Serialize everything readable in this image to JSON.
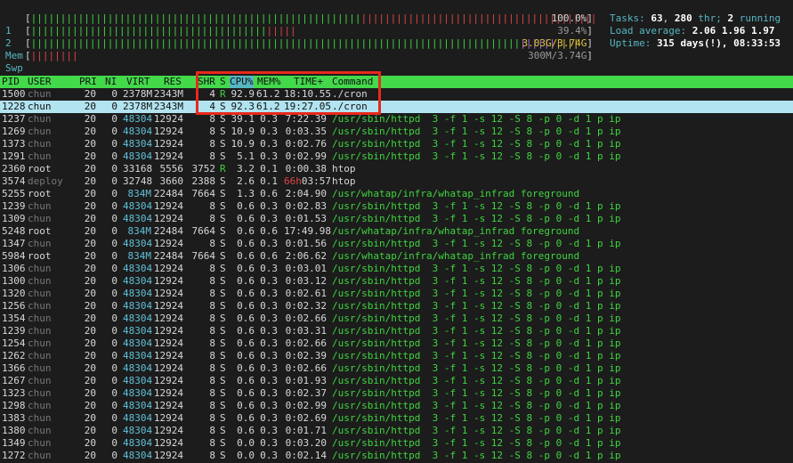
{
  "meters": [
    {
      "label": "1",
      "value": "100.0%"
    },
    {
      "label": "2",
      "value": "39.4%"
    },
    {
      "label": "Mem",
      "value": "3.03G/3.74G"
    },
    {
      "label": "Swp",
      "value": "300M/3.74G"
    }
  ],
  "summary": {
    "tasks_label": "Tasks: ",
    "tasks": "63",
    "tasks_sep": ", ",
    "threads": "280",
    "threads_label": " thr; ",
    "running": "2",
    "running_label": " running",
    "load_label": "Load average: ",
    "load1": "2.06",
    "load5": "1.96",
    "load15": "1.97",
    "uptime_label": "Uptime: ",
    "uptime": "315 days(!), 08:33:53"
  },
  "columns": {
    "pid": "PID",
    "user": "USER",
    "pri": "PRI",
    "ni": "NI",
    "virt": "VIRT",
    "res": "RES",
    "shr": "SHR",
    "s": "S",
    "cpu": "CPU%",
    "mem": "MEM%",
    "time": "TIME+",
    "cmd": "Command"
  },
  "processes": [
    {
      "pid": "1500",
      "user": "chun",
      "pri": "20",
      "ni": "0",
      "virt": "2378M",
      "res": "2343M",
      "shr": "4",
      "s": "R",
      "cpu": "92.9",
      "mem": "61.2",
      "time": "18:10.55",
      "cmd": "./cron"
    },
    {
      "pid": "1228",
      "user": "chun",
      "pri": "20",
      "ni": "0",
      "virt": "2378M",
      "res": "2343M",
      "shr": "4",
      "s": "S",
      "cpu": "92.3",
      "mem": "61.2",
      "time": "19:27.05",
      "cmd": "./cron"
    },
    {
      "pid": "1237",
      "user": "chun",
      "pri": "20",
      "ni": "0",
      "virt": "48304",
      "res": "12924",
      "shr": "8",
      "s": "S",
      "cpu": "39.1",
      "mem": "0.3",
      "time": "7:22.39",
      "cmd": "/usr/sbin/httpd  3 -f 1 -s 12 -S 8 -p 0 -d 1 p ip"
    },
    {
      "pid": "1269",
      "user": "chun",
      "pri": "20",
      "ni": "0",
      "virt": "48304",
      "res": "12924",
      "shr": "8",
      "s": "S",
      "cpu": "10.9",
      "mem": "0.3",
      "time": "0:03.35",
      "cmd": "/usr/sbin/httpd  3 -f 1 -s 12 -S 8 -p 0 -d 1 p ip"
    },
    {
      "pid": "1373",
      "user": "chun",
      "pri": "20",
      "ni": "0",
      "virt": "48304",
      "res": "12924",
      "shr": "8",
      "s": "S",
      "cpu": "10.9",
      "mem": "0.3",
      "time": "0:02.76",
      "cmd": "/usr/sbin/httpd  3 -f 1 -s 12 -S 8 -p 0 -d 1 p ip"
    },
    {
      "pid": "1291",
      "user": "chun",
      "pri": "20",
      "ni": "0",
      "virt": "48304",
      "res": "12924",
      "shr": "8",
      "s": "S",
      "cpu": "5.1",
      "mem": "0.3",
      "time": "0:02.99",
      "cmd": "/usr/sbin/httpd  3 -f 1 -s 12 -S 8 -p 0 -d 1 p ip"
    },
    {
      "pid": "2360",
      "user": "root",
      "pri": "20",
      "ni": "0",
      "virt": "33168",
      "res": "5556",
      "shr": "3752",
      "s": "R",
      "cpu": "3.2",
      "mem": "0.1",
      "time": "0:00.38",
      "cmd": "htop"
    },
    {
      "pid": "3574",
      "user": "deploy",
      "pri": "20",
      "ni": "0",
      "virt": "32748",
      "res": "3660",
      "shr": "2388",
      "s": "S",
      "cpu": "2.6",
      "mem": "0.1",
      "time_h": "66h",
      "time": "03:57",
      "cmd": "htop"
    },
    {
      "pid": "5255",
      "user": "root",
      "pri": "20",
      "ni": "0",
      "virt": "834M",
      "res": "22484",
      "shr": "7664",
      "s": "S",
      "cpu": "1.3",
      "mem": "0.6",
      "time": "2:04.90",
      "cmd": "/usr/whatap/infra/whatap_infrad foreground"
    },
    {
      "pid": "1239",
      "user": "chun",
      "pri": "20",
      "ni": "0",
      "virt": "48304",
      "res": "12924",
      "shr": "8",
      "s": "S",
      "cpu": "0.6",
      "mem": "0.3",
      "time": "0:02.83",
      "cmd": "/usr/sbin/httpd  3 -f 1 -s 12 -S 8 -p 0 -d 1 p ip"
    },
    {
      "pid": "1309",
      "user": "chun",
      "pri": "20",
      "ni": "0",
      "virt": "48304",
      "res": "12924",
      "shr": "8",
      "s": "S",
      "cpu": "0.6",
      "mem": "0.3",
      "time": "0:01.53",
      "cmd": "/usr/sbin/httpd  3 -f 1 -s 12 -S 8 -p 0 -d 1 p ip"
    },
    {
      "pid": "5248",
      "user": "root",
      "pri": "20",
      "ni": "0",
      "virt": "834M",
      "res": "22484",
      "shr": "7664",
      "s": "S",
      "cpu": "0.6",
      "mem": "0.6",
      "time": "17:49.98",
      "cmd": "/usr/whatap/infra/whatap_infrad foreground"
    },
    {
      "pid": "1347",
      "user": "chun",
      "pri": "20",
      "ni": "0",
      "virt": "48304",
      "res": "12924",
      "shr": "8",
      "s": "S",
      "cpu": "0.6",
      "mem": "0.3",
      "time": "0:01.56",
      "cmd": "/usr/sbin/httpd  3 -f 1 -s 12 -S 8 -p 0 -d 1 p ip"
    },
    {
      "pid": "5984",
      "user": "root",
      "pri": "20",
      "ni": "0",
      "virt": "834M",
      "res": "22484",
      "shr": "7664",
      "s": "S",
      "cpu": "0.6",
      "mem": "0.6",
      "time": "2:06.62",
      "cmd": "/usr/whatap/infra/whatap_infrad foreground"
    },
    {
      "pid": "1306",
      "user": "chun",
      "pri": "20",
      "ni": "0",
      "virt": "48304",
      "res": "12924",
      "shr": "8",
      "s": "S",
      "cpu": "0.6",
      "mem": "0.3",
      "time": "0:03.01",
      "cmd": "/usr/sbin/httpd  3 -f 1 -s 12 -S 8 -p 0 -d 1 p ip"
    },
    {
      "pid": "1300",
      "user": "chun",
      "pri": "20",
      "ni": "0",
      "virt": "48304",
      "res": "12924",
      "shr": "8",
      "s": "S",
      "cpu": "0.6",
      "mem": "0.3",
      "time": "0:03.12",
      "cmd": "/usr/sbin/httpd  3 -f 1 -s 12 -S 8 -p 0 -d 1 p ip"
    },
    {
      "pid": "1320",
      "user": "chun",
      "pri": "20",
      "ni": "0",
      "virt": "48304",
      "res": "12924",
      "shr": "8",
      "s": "S",
      "cpu": "0.6",
      "mem": "0.3",
      "time": "0:02.61",
      "cmd": "/usr/sbin/httpd  3 -f 1 -s 12 -S 8 -p 0 -d 1 p ip"
    },
    {
      "pid": "1256",
      "user": "chun",
      "pri": "20",
      "ni": "0",
      "virt": "48304",
      "res": "12924",
      "shr": "8",
      "s": "S",
      "cpu": "0.6",
      "mem": "0.3",
      "time": "0:02.32",
      "cmd": "/usr/sbin/httpd  3 -f 1 -s 12 -S 8 -p 0 -d 1 p ip"
    },
    {
      "pid": "1354",
      "user": "chun",
      "pri": "20",
      "ni": "0",
      "virt": "48304",
      "res": "12924",
      "shr": "8",
      "s": "S",
      "cpu": "0.6",
      "mem": "0.3",
      "time": "0:02.66",
      "cmd": "/usr/sbin/httpd  3 -f 1 -s 12 -S 8 -p 0 -d 1 p ip"
    },
    {
      "pid": "1239",
      "user": "chun",
      "pri": "20",
      "ni": "0",
      "virt": "48304",
      "res": "12924",
      "shr": "8",
      "s": "S",
      "cpu": "0.6",
      "mem": "0.3",
      "time": "0:03.31",
      "cmd": "/usr/sbin/httpd  3 -f 1 -s 12 -S 8 -p 0 -d 1 p ip"
    },
    {
      "pid": "1254",
      "user": "chun",
      "pri": "20",
      "ni": "0",
      "virt": "48304",
      "res": "12924",
      "shr": "8",
      "s": "S",
      "cpu": "0.6",
      "mem": "0.3",
      "time": "0:02.66",
      "cmd": "/usr/sbin/httpd  3 -f 1 -s 12 -S 8 -p 0 -d 1 p ip"
    },
    {
      "pid": "1262",
      "user": "chun",
      "pri": "20",
      "ni": "0",
      "virt": "48304",
      "res": "12924",
      "shr": "8",
      "s": "S",
      "cpu": "0.6",
      "mem": "0.3",
      "time": "0:02.39",
      "cmd": "/usr/sbin/httpd  3 -f 1 -s 12 -S 8 -p 0 -d 1 p ip"
    },
    {
      "pid": "1366",
      "user": "chun",
      "pri": "20",
      "ni": "0",
      "virt": "48304",
      "res": "12924",
      "shr": "8",
      "s": "S",
      "cpu": "0.6",
      "mem": "0.3",
      "time": "0:02.66",
      "cmd": "/usr/sbin/httpd  3 -f 1 -s 12 -S 8 -p 0 -d 1 p ip"
    },
    {
      "pid": "1267",
      "user": "chun",
      "pri": "20",
      "ni": "0",
      "virt": "48304",
      "res": "12924",
      "shr": "8",
      "s": "S",
      "cpu": "0.6",
      "mem": "0.3",
      "time": "0:01.93",
      "cmd": "/usr/sbin/httpd  3 -f 1 -s 12 -S 8 -p 0 -d 1 p ip"
    },
    {
      "pid": "1323",
      "user": "chun",
      "pri": "20",
      "ni": "0",
      "virt": "48304",
      "res": "12924",
      "shr": "8",
      "s": "S",
      "cpu": "0.6",
      "mem": "0.3",
      "time": "0:02.37",
      "cmd": "/usr/sbin/httpd  3 -f 1 -s 12 -S 8 -p 0 -d 1 p ip"
    },
    {
      "pid": "1298",
      "user": "chun",
      "pri": "20",
      "ni": "0",
      "virt": "48304",
      "res": "12924",
      "shr": "8",
      "s": "S",
      "cpu": "0.6",
      "mem": "0.3",
      "time": "0:02.99",
      "cmd": "/usr/sbin/httpd  3 -f 1 -s 12 -S 8 -p 0 -d 1 p ip"
    },
    {
      "pid": "1383",
      "user": "chun",
      "pri": "20",
      "ni": "0",
      "virt": "48304",
      "res": "12924",
      "shr": "8",
      "s": "S",
      "cpu": "0.6",
      "mem": "0.3",
      "time": "0:02.69",
      "cmd": "/usr/sbin/httpd  3 -f 1 -s 12 -S 8 -p 0 -d 1 p ip"
    },
    {
      "pid": "1380",
      "user": "chun",
      "pri": "20",
      "ni": "0",
      "virt": "48304",
      "res": "12924",
      "shr": "8",
      "s": "S",
      "cpu": "0.6",
      "mem": "0.3",
      "time": "0:01.71",
      "cmd": "/usr/sbin/httpd  3 -f 1 -s 12 -S 8 -p 0 -d 1 p ip"
    },
    {
      "pid": "1349",
      "user": "chun",
      "pri": "20",
      "ni": "0",
      "virt": "48304",
      "res": "12924",
      "shr": "8",
      "s": "S",
      "cpu": "0.0",
      "mem": "0.3",
      "time": "0:03.20",
      "cmd": "/usr/sbin/httpd  3 -f 1 -s 12 -S 8 -p 0 -d 1 p ip"
    },
    {
      "pid": "1272",
      "user": "chun",
      "pri": "20",
      "ni": "0",
      "virt": "48304",
      "res": "12924",
      "shr": "8",
      "s": "S",
      "cpu": "0.0",
      "mem": "0.3",
      "time": "0:02.14",
      "cmd": "/usr/sbin/httpd  3 -f 1 -s 12 -S 8 -p 0 -d 1 p ip"
    }
  ],
  "colors": {
    "header_bg": "#43d94b",
    "selected_bg": "#b2e3f0",
    "highlight_box": "#e8291c"
  }
}
